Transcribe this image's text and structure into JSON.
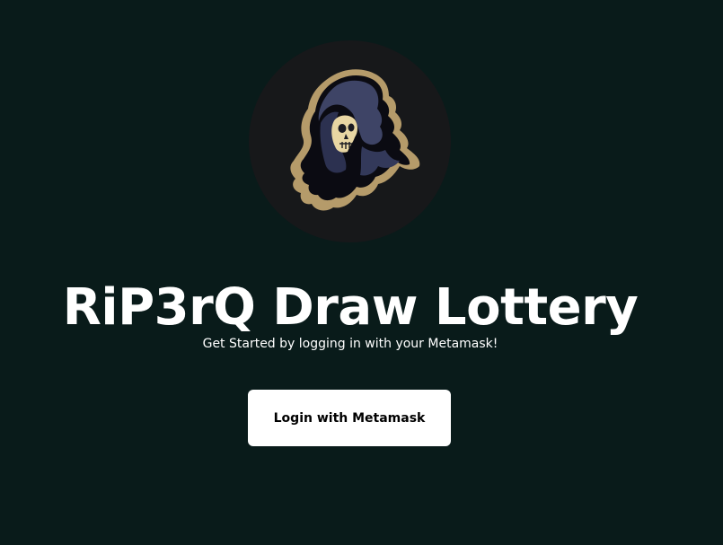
{
  "logo": {
    "icon": "hooded-reaper-skull-icon",
    "colors": {
      "circle_background": "#17181a",
      "cloak": "#3e4466",
      "cloak_shadow": "#0b0b12",
      "gold_outline": "#b59b6a",
      "skull": "#e8d6a3"
    }
  },
  "hero": {
    "title": "RiP3rQ Draw Lottery",
    "subtitle": "Get Started by logging in with your Metamask!"
  },
  "login": {
    "label": "Login with Metamask"
  },
  "colors": {
    "page_background": "#091b1a",
    "text": "#ffffff",
    "button_background": "#ffffff",
    "button_text": "#000000"
  }
}
